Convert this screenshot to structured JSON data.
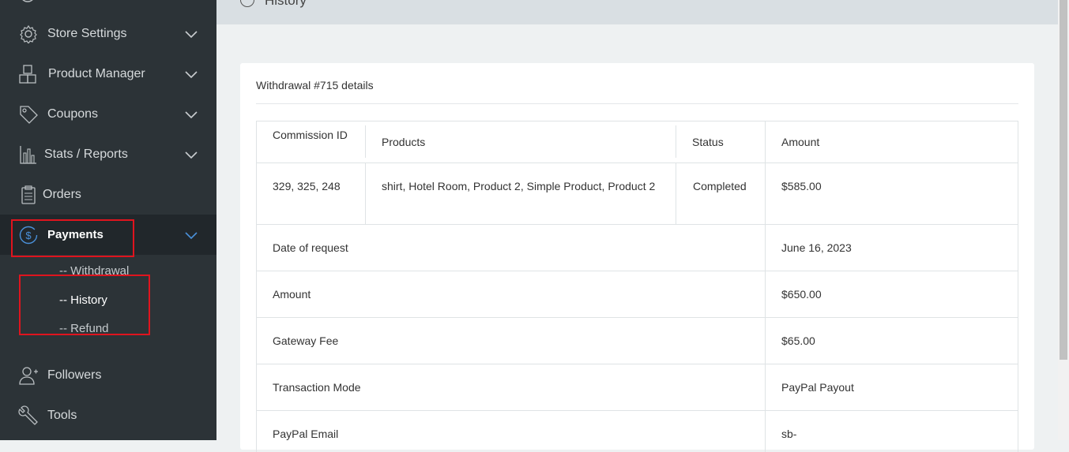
{
  "sidebar": {
    "items": [
      {
        "label": "Store Settings",
        "icon": "gear-icon"
      },
      {
        "label": "Product Manager",
        "icon": "boxes-icon"
      },
      {
        "label": "Coupons",
        "icon": "tag-icon"
      },
      {
        "label": "Stats / Reports",
        "icon": "bar-chart-icon"
      },
      {
        "label": "Orders",
        "icon": "clipboard-icon"
      },
      {
        "label": "Payments",
        "icon": "dollar-circle-icon"
      },
      {
        "label": "Followers",
        "icon": "user-plus-icon"
      },
      {
        "label": "Tools",
        "icon": "wrench-icon"
      }
    ],
    "payments_sub": [
      {
        "label": "-- Withdrawal"
      },
      {
        "label": "-- History"
      },
      {
        "label": "-- Refund"
      }
    ]
  },
  "header": {
    "title": "History"
  },
  "card": {
    "title": "Withdrawal #715 details",
    "columns": [
      "Commission ID",
      "Products",
      "Status",
      "Amount"
    ],
    "row": {
      "commission_ids": "329, 325, 248",
      "products": "shirt, Hotel Room, Product 2, Simple Product, Product 2",
      "status": "Completed",
      "amount": "$585.00"
    },
    "details": [
      {
        "label": "Date of request",
        "value": "June 16, 2023"
      },
      {
        "label": "Amount",
        "value": "$650.00"
      },
      {
        "label": "Gateway Fee",
        "value": "$65.00"
      },
      {
        "label": "Transaction Mode",
        "value": "PayPal Payout"
      },
      {
        "label": "PayPal Email",
        "value": "sb-"
      }
    ]
  },
  "colors": {
    "sidebar_bg": "#2c3337",
    "active_bg": "#21272b",
    "accent": "#4a90d9",
    "highlight": "#e0141e"
  }
}
